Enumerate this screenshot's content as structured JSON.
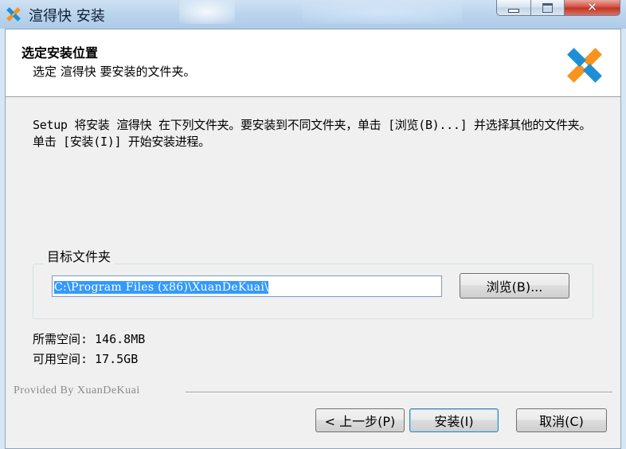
{
  "window": {
    "title": "渲得快 安装",
    "controls": {
      "minimize": "minimize",
      "maximize": "maximize",
      "close": "✕"
    }
  },
  "header": {
    "title": "选定安装位置",
    "subtitle": "选定 渲得快 要安装的文件夹。"
  },
  "description": "Setup 将安装 渲得快 在下列文件夹。要安装到不同文件夹，单击 [浏览(B)...] 并选择其他的文件夹。 单击 [安装(I)] 开始安装进程。",
  "destination": {
    "label": "目标文件夹",
    "path": "C:\\Program Files (x86)\\XuanDeKuai\\",
    "browse_label": "浏览(B)..."
  },
  "space": {
    "required": "所需空间: 146.8MB",
    "available": "可用空间: 17.5GB"
  },
  "branding": "Provided By XuanDeKuai",
  "buttons": {
    "back": "< 上一步(P)",
    "install": "安装(I)",
    "cancel": "取消(C)"
  },
  "colors": {
    "logo_orange": "#f7941d",
    "logo_blue": "#1e8fd6",
    "selection": "#3399ff"
  }
}
